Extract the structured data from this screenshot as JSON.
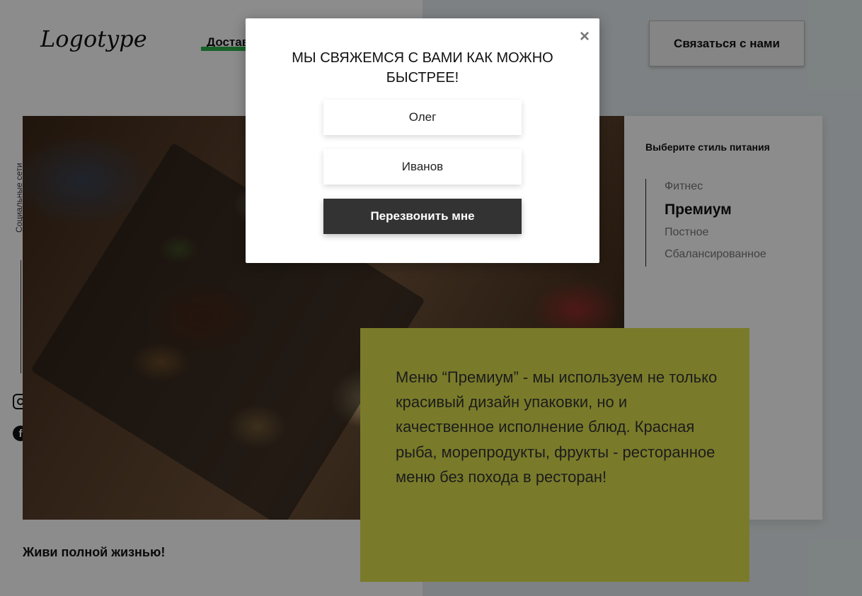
{
  "header": {
    "logo": "Logotype",
    "nav_item": "Доставка",
    "contact_button": "Связаться с нами"
  },
  "social": {
    "label": "Социальные сети",
    "icons": [
      "instagram-icon",
      "facebook-icon"
    ],
    "facebook_glyph": "f"
  },
  "diet": {
    "title": "Выберите стиль питания",
    "options": [
      "Фитнес",
      "Премиум",
      "Постное",
      "Сбалансированное"
    ],
    "active": "Премиум"
  },
  "description": "Меню “Премиум” - мы используем не только красивый дизайн упаковки, но и качественное исполнение блюд. Красная рыба, морепродукты, фрукты - ресторанное меню без похода в ресторан!",
  "tagline": "Живи полной жизнью!",
  "modal": {
    "title": "Мы свяжемся с вами как можно быстрее!",
    "close": "×",
    "first_name_value": "Олег",
    "last_name_value": "Иванов",
    "submit_label": "Перезвонить мне"
  },
  "colors": {
    "accent_green": "#2db34a",
    "description_bg": "#dde14d",
    "button_dark": "#333333"
  }
}
